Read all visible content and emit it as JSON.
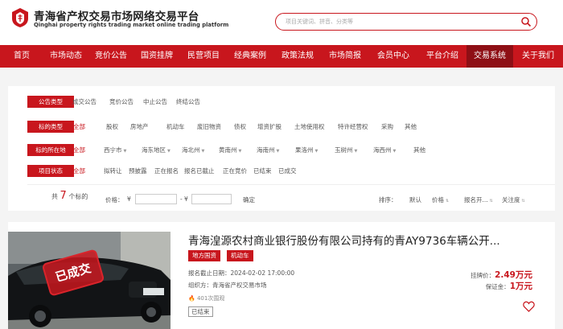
{
  "header": {
    "title": "青海省产权交易市场网络交易平台",
    "subtitle": "Qinghai property rights trading market online trading platform",
    "search_placeholder": "项目关键词、拼音、分类等"
  },
  "nav": {
    "items": [
      "首页",
      "市场动态",
      "竞价公告",
      "国资挂牌",
      "民营项目",
      "经典案例",
      "政策法规",
      "市场简报",
      "会员中心",
      "平台介绍",
      "交易系统",
      "关于我们"
    ],
    "active_index": 10
  },
  "filters": {
    "announcement_type": {
      "label": "公告类型",
      "options": [
        "成交公告",
        "竞价公告",
        "中止公告",
        "终结公告"
      ]
    },
    "asset_type": {
      "label": "标的类型",
      "options": [
        "全部",
        "股权",
        "房地产",
        "机动车",
        "废旧物资",
        "债权",
        "增资扩股",
        "土地使用权",
        "特许经营权",
        "采购",
        "其他"
      ]
    },
    "location": {
      "label": "标的所在地",
      "options": [
        "全部",
        "西宁市",
        "海东地区",
        "海北州",
        "黄南州",
        "海南州",
        "果洛州",
        "玉树州",
        "海西州",
        "其他"
      ]
    },
    "project_status": {
      "label": "项目状态",
      "options": [
        "全部",
        "拟转让",
        "预披露",
        "正在报名",
        "报名已截止",
        "正在竞价",
        "已结束",
        "已成交"
      ]
    }
  },
  "sort_bar": {
    "count_prefix": "共",
    "count": "7",
    "count_suffix": "个标的",
    "price_label": "价格：",
    "price_min": "¥",
    "price_sep": "-",
    "price_max": "¥",
    "confirm": "确定",
    "sort_label": "排序：",
    "sort_options": [
      "默认",
      "价格",
      "报名开...",
      "关注度"
    ]
  },
  "listing": {
    "stamp": "已成交",
    "title": "青海湟源农村商业银行股份有限公司持有的青AY9736车辆公开...",
    "tags": [
      "地方国资",
      "机动车"
    ],
    "deadline_label": "报名截止日期：",
    "deadline": "2024-02-02 17:00:00",
    "organizer_label": "组织方：",
    "organizer": "青海省产权交易市场",
    "views": "401次围观",
    "status": "已结束",
    "listing_price_label": "挂牌价：",
    "listing_price": "2.49万元",
    "deposit_label": "保证金：",
    "deposit": "1万元"
  },
  "colors": {
    "brand_red": "#c8161d",
    "active_nav": "#8e0f15"
  }
}
